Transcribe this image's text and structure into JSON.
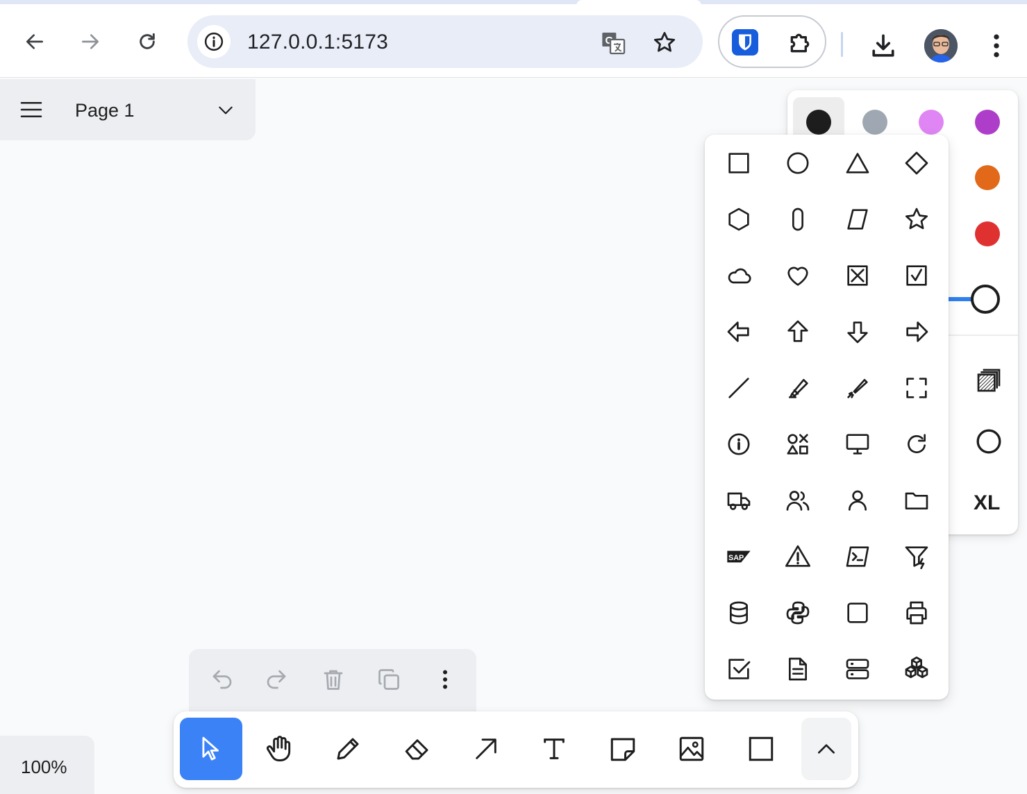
{
  "browser": {
    "url": "127.0.0.1:5173",
    "icons": [
      "back-icon",
      "forward-icon",
      "reload-icon",
      "site-info-icon",
      "translate-icon",
      "bookmark-star-icon",
      "bitwarden-icon",
      "extensions-icon",
      "download-icon",
      "profile-avatar",
      "browser-menu-icon"
    ]
  },
  "page_menu": {
    "page_name": "Page 1"
  },
  "style_panel": {
    "colors": [
      "#1d1d1d",
      "#9fa8b2",
      "#e085f4",
      "#ae3ec9",
      "#e16919",
      "#e03131"
    ],
    "selected_color": "#1d1d1d",
    "opacity": 1.0,
    "size_label": "XL"
  },
  "shape_panel": {
    "shapes": [
      "rectangle",
      "ellipse",
      "triangle",
      "diamond",
      "hexagon",
      "oval",
      "trapezoid",
      "star",
      "cloud",
      "heart",
      "x-box",
      "check-box",
      "arrow-left",
      "arrow-up",
      "arrow-down",
      "arrow-right",
      "line",
      "highlight",
      "laser",
      "frame",
      "info",
      "shapes",
      "desktop",
      "refresh",
      "truck",
      "users",
      "user",
      "folder",
      "sap",
      "warning",
      "terminal",
      "filter",
      "database",
      "python",
      "square",
      "printer",
      "checkbox",
      "document",
      "server",
      "cubes"
    ]
  },
  "zoom": {
    "label": "100%"
  },
  "tools": [
    "select",
    "hand",
    "draw",
    "eraser",
    "arrow",
    "text",
    "note",
    "image",
    "rectangle"
  ],
  "active_tool": "select"
}
